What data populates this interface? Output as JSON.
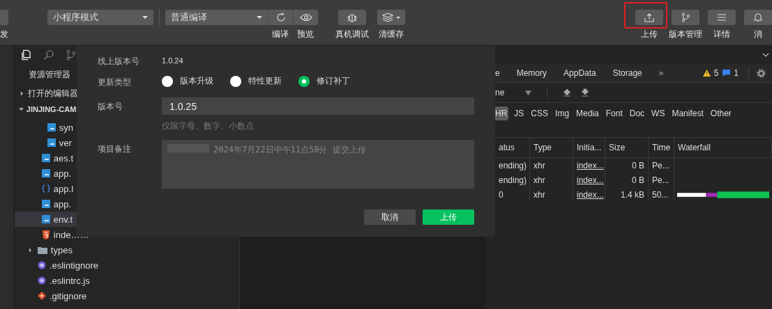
{
  "toolbar": {
    "left_label": "发",
    "mode_select": {
      "value": "小程序模式"
    },
    "compile_select": {
      "value": "普通编译"
    },
    "tools": [
      {
        "kind": "refresh",
        "label": "编译"
      },
      {
        "kind": "eye",
        "label": "预览"
      },
      {
        "kind": "bug",
        "label": "真机调试"
      },
      {
        "kind": "layers",
        "label": "清缓存"
      }
    ],
    "right_tools": [
      {
        "kind": "upload",
        "label": "上传",
        "highlighted": true
      },
      {
        "kind": "branch",
        "label": "版本管理",
        "highlighted": false
      },
      {
        "kind": "list",
        "label": "详情",
        "highlighted": false
      },
      {
        "kind": "bell",
        "label": "消",
        "highlighted": false
      }
    ]
  },
  "sidebar": {
    "title": "资源管理器",
    "sections": [
      {
        "label": "打开的编辑器",
        "expanded": false
      }
    ],
    "project": {
      "label": "JINJING-CAM",
      "expanded": true,
      "children": [
        {
          "children": [
            {
              "children": [
                {
                  "label": "syn",
                  "kind": "ts",
                  "selected": false
                },
                {
                  "label": "ver",
                  "kind": "ts",
                  "selected": false
                }
              ]
            },
            {
              "label": "aes.t",
              "kind": "ts",
              "selected": false
            },
            {
              "label": "app.",
              "kind": "ts",
              "selected": false
            },
            {
              "label": "app.l",
              "kind": "json",
              "selected": false
            },
            {
              "label": "app.",
              "kind": "ts",
              "selected": false
            },
            {
              "label": "env.t",
              "kind": "ts",
              "selected": true
            },
            {
              "label": "inde……",
              "kind": "html",
              "selected": false
            }
          ]
        },
        {
          "label": "types",
          "kind": "folder",
          "selected": false,
          "expanded": false
        },
        {
          "label": ".eslintignore",
          "kind": "eslint",
          "selected": false
        },
        {
          "label": ".eslintrc.js",
          "kind": "eslint",
          "selected": false
        },
        {
          "label": ".gitignore",
          "kind": "git",
          "selected": false
        }
      ]
    }
  },
  "dialog": {
    "fields": [
      {
        "kind": "text",
        "label": "线上版本号",
        "value": "1.0.24"
      },
      {
        "kind": "radio",
        "label": "更新类型",
        "options": [
          {
            "label": "版本升级",
            "selected": false
          },
          {
            "label": "特性更新",
            "selected": false
          },
          {
            "label": "修订补丁",
            "selected": true
          }
        ]
      },
      {
        "kind": "input",
        "label": "版本号",
        "value": "1.0.25",
        "hint": "仅限字母、数字、小数点"
      },
      {
        "kind": "textarea",
        "label": "项目备注",
        "value": "2024年7月22日中午11点58分 提交上传"
      }
    ],
    "buttons": [
      {
        "label": "取消",
        "kind": "cancel"
      },
      {
        "label": "上传",
        "kind": "primary"
      }
    ]
  },
  "devtools": {
    "tabs": [
      {
        "label": "e",
        "selected": false
      },
      {
        "label": "Memory",
        "selected": false
      },
      {
        "label": "AppData",
        "selected": false
      },
      {
        "label": "Storage",
        "selected": false
      }
    ],
    "more": "»",
    "warnings": "5",
    "messages": "1",
    "throttle": "ne",
    "type_filters": [
      {
        "label": "HR",
        "selected": true
      },
      {
        "label": "JS",
        "selected": false
      },
      {
        "label": "CSS",
        "selected": false
      },
      {
        "label": "Img",
        "selected": false
      },
      {
        "label": "Media",
        "selected": false
      },
      {
        "label": "Font",
        "selected": false
      },
      {
        "label": "Doc",
        "selected": false
      },
      {
        "label": "WS",
        "selected": false
      },
      {
        "label": "Manifest",
        "selected": false
      },
      {
        "label": "Other",
        "selected": false
      }
    ],
    "table": {
      "columns": [
        "atus",
        "Type",
        "Initia...",
        "Size",
        "Time",
        "Waterfall"
      ],
      "rows": [
        {
          "status": "ending)",
          "type": "xhr",
          "initiator": "index...",
          "size": "0 B",
          "time": "Pe...",
          "waterfall": false
        },
        {
          "status": "ending)",
          "type": "xhr",
          "initiator": "index...",
          "size": "0 B",
          "time": "Pe...",
          "waterfall": false
        },
        {
          "status": "0",
          "type": "xhr",
          "initiator": "index...",
          "size": "1.4 kB",
          "time": "50...",
          "waterfall": true
        }
      ]
    }
  }
}
